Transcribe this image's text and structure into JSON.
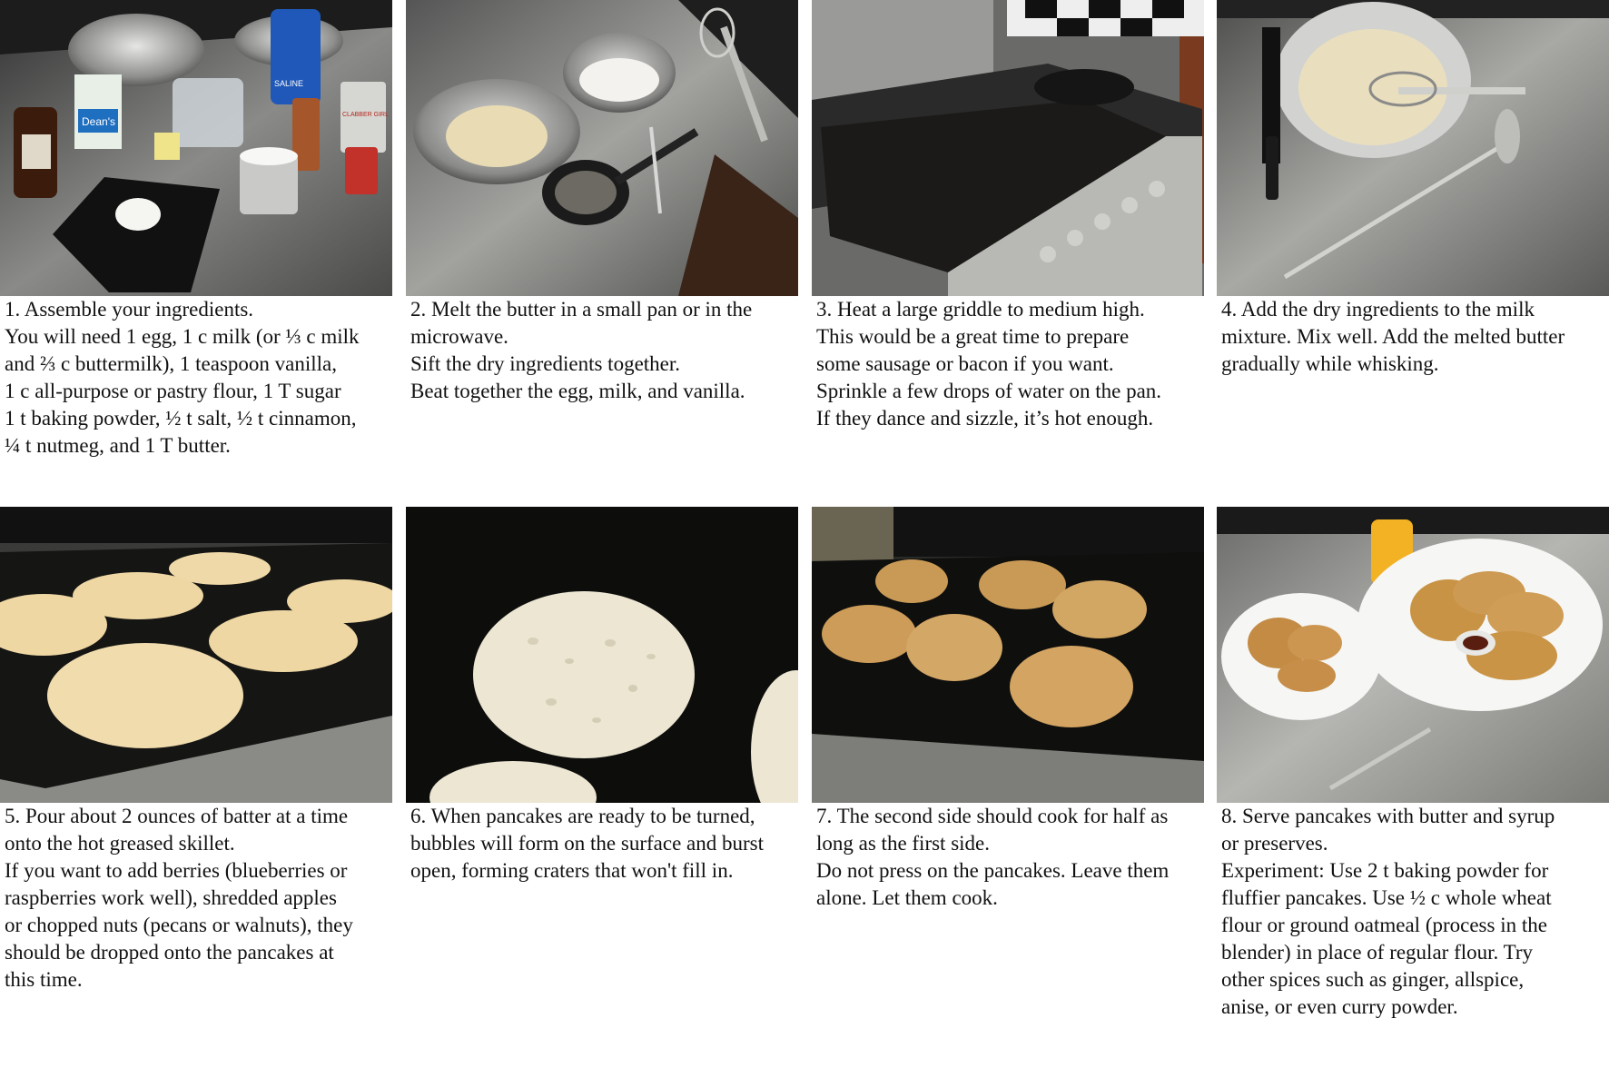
{
  "steps": [
    {
      "lines": [
        "1. Assemble your ingredients.",
        "You will need 1 egg, 1 c milk (or ⅓ c milk",
        "and ⅔ c buttermilk), 1 teaspoon vanilla,",
        "1 c all-purpose or pastry flour, 1 T sugar",
        "1 t baking powder, ½ t salt, ½ t cinnamon,",
        "¼ t nutmeg, and 1 T butter."
      ]
    },
    {
      "lines": [
        "2. Melt the butter in a small pan or in the",
        "microwave.",
        "Sift the dry ingredients together.",
        "Beat together the egg, milk, and vanilla."
      ]
    },
    {
      "lines": [
        "3. Heat a large griddle to medium high.",
        "This would be a great time to prepare",
        "some sausage or bacon if you want.",
        "Sprinkle a few drops of water on the pan.",
        "If they dance and sizzle, it’s hot enough."
      ]
    },
    {
      "lines": [
        "4. Add the dry ingredients to the milk",
        "mixture. Mix well. Add the melted butter",
        "gradually while whisking."
      ]
    },
    {
      "lines": [
        "5. Pour about 2 ounces of batter at a time",
        "onto the hot greased skillet.",
        "If you want to add berries (blueberries or",
        "raspberries work well), shredded apples",
        "or chopped nuts (pecans or walnuts), they",
        "should be dropped onto the pancakes at",
        "this time."
      ]
    },
    {
      "lines": [
        "6. When pancakes are ready to be turned,",
        "bubbles will form on the surface and burst",
        "open, forming craters that won't fill in."
      ]
    },
    {
      "lines": [
        "7. The second side should cook for half as",
        "long as the first side.",
        "Do not press on the pancakes. Leave them",
        "alone. Let them cook."
      ]
    },
    {
      "lines": [
        "8. Serve pancakes with butter and syrup",
        "or preserves.",
        "Experiment: Use 2 t baking powder for",
        "fluffier pancakes.  Use ½ c whole wheat",
        "flour or ground oatmeal (process in the",
        "blender) in place of regular flour. Try",
        "other spices such as ginger, allspice,",
        "anise, or even curry powder."
      ]
    }
  ],
  "product_labels": {
    "deans": "Dean's",
    "salt": "SALINE",
    "clabber": "CLABBER GIRL"
  }
}
